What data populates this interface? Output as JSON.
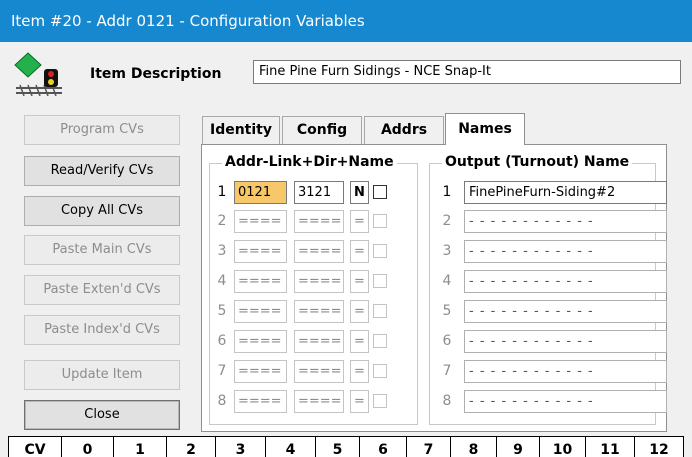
{
  "window": {
    "title": "Item #20 - Addr 0121 - Configuration Variables"
  },
  "header": {
    "description_label": "Item Description",
    "description_value": "Fine Pine Furn Sidings - NCE Snap-It",
    "logo_icon": "signal-track-icon"
  },
  "buttons": [
    {
      "label": "Program CVs",
      "enabled": false
    },
    {
      "label": "Read/Verify CVs",
      "enabled": true
    },
    {
      "label": "Copy All CVs",
      "enabled": true
    },
    {
      "label": "Paste Main CVs",
      "enabled": false
    },
    {
      "label": "Paste Exten'd CVs",
      "enabled": false
    },
    {
      "label": "Paste Index'd CVs",
      "enabled": false
    },
    {
      "label": "Update Item",
      "enabled": false
    },
    {
      "label": "Close",
      "enabled": true
    }
  ],
  "tabs": [
    {
      "label": "Identity",
      "active": false
    },
    {
      "label": "Config",
      "active": false
    },
    {
      "label": "Addrs",
      "active": false
    },
    {
      "label": "Names",
      "active": true
    }
  ],
  "addr_group": {
    "title": "Addr-Link+Dir+Name",
    "rows": [
      {
        "num": "1",
        "addr": "0121",
        "link": "3121",
        "dir": "N",
        "enabled": true
      },
      {
        "num": "2",
        "addr": "====",
        "link": "====",
        "dir": "=",
        "enabled": false
      },
      {
        "num": "3",
        "addr": "====",
        "link": "====",
        "dir": "=",
        "enabled": false
      },
      {
        "num": "4",
        "addr": "====",
        "link": "====",
        "dir": "=",
        "enabled": false
      },
      {
        "num": "5",
        "addr": "====",
        "link": "====",
        "dir": "=",
        "enabled": false
      },
      {
        "num": "6",
        "addr": "====",
        "link": "====",
        "dir": "=",
        "enabled": false
      },
      {
        "num": "7",
        "addr": "====",
        "link": "====",
        "dir": "=",
        "enabled": false
      },
      {
        "num": "8",
        "addr": "====",
        "link": "====",
        "dir": "=",
        "enabled": false
      }
    ]
  },
  "names_group": {
    "title": "Output (Turnout) Name",
    "rows": [
      {
        "num": "1",
        "name": "FinePineFurn-Siding#2",
        "enabled": true
      },
      {
        "num": "2",
        "name": "- - - - - - - - - - - -",
        "enabled": false
      },
      {
        "num": "3",
        "name": "- - - - - - - - - - - -",
        "enabled": false
      },
      {
        "num": "4",
        "name": "- - - - - - - - - - - -",
        "enabled": false
      },
      {
        "num": "5",
        "name": "- - - - - - - - - - - -",
        "enabled": false
      },
      {
        "num": "6",
        "name": "- - - - - - - - - - - -",
        "enabled": false
      },
      {
        "num": "7",
        "name": "- - - - - - - - - - - -",
        "enabled": false
      },
      {
        "num": "8",
        "name": "- - - - - - - - - - - -",
        "enabled": false
      }
    ]
  },
  "cv_header": {
    "cells": [
      "CV",
      "0",
      "1",
      "2",
      "3",
      "4",
      "5",
      "6",
      "7",
      "8",
      "9",
      "10",
      "11",
      "12"
    ]
  },
  "colors": {
    "titlebar": "#1588cf",
    "highlight": "#f7c86a"
  }
}
